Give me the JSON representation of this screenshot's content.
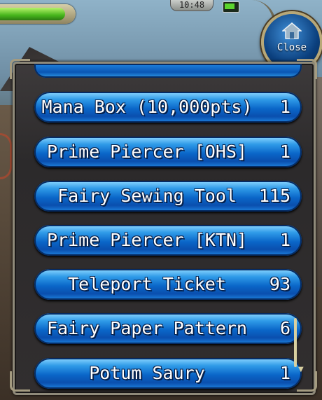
{
  "hud": {
    "time": "10:48",
    "hp_fraction": 0.92
  },
  "close_button": {
    "label": "Close",
    "icon": "home-icon"
  },
  "items": [
    {
      "name": "Mana Box (10,000pts)",
      "count": "1"
    },
    {
      "name": "Prime Piercer [OHS]",
      "count": "1"
    },
    {
      "name": "Fairy Sewing Tool",
      "count": "115"
    },
    {
      "name": "Prime Piercer [KTN]",
      "count": "1"
    },
    {
      "name": "Teleport Ticket",
      "count": "93"
    },
    {
      "name": "Fairy Paper Pattern",
      "count": "6"
    },
    {
      "name": "Potum Saury",
      "count": "1"
    }
  ],
  "colors": {
    "item_blue": "#0a66c8",
    "panel": "#2c2a2b",
    "hp_green": "#47b51c"
  }
}
